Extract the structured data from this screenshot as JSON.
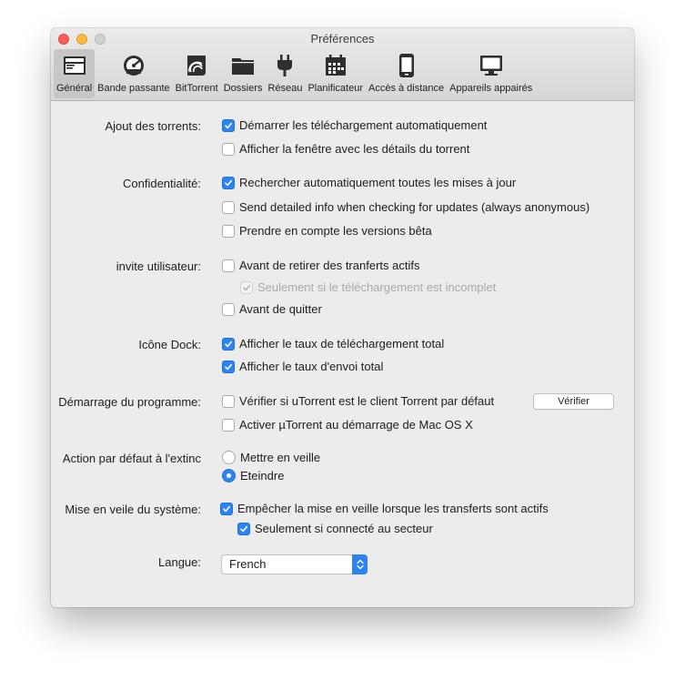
{
  "window": {
    "title": "Préférences"
  },
  "toolbar": [
    {
      "label": "Général",
      "icon": "general-icon",
      "selected": true
    },
    {
      "label": "Bande passante",
      "icon": "gauge-icon"
    },
    {
      "label": "BitTorrent",
      "icon": "bittorrent-icon"
    },
    {
      "label": "Dossiers",
      "icon": "folder-icon"
    },
    {
      "label": "Réseau",
      "icon": "plug-icon"
    },
    {
      "label": "Planificateur",
      "icon": "calendar-icon"
    },
    {
      "label": "Accès à distance",
      "icon": "phone-icon"
    },
    {
      "label": "Appareils appairés",
      "icon": "monitor-icon"
    }
  ],
  "sections": {
    "ajout": {
      "label": "Ajout des torrents:",
      "options": [
        {
          "label": "Démarrer les téléchargement automatiquement",
          "checked": true
        },
        {
          "label": "Afficher la fenêtre avec les détails du torrent",
          "checked": false
        }
      ]
    },
    "confidentialite": {
      "label": "Confidentialité:",
      "options": [
        {
          "label": "Rechercher automatiquement toutes les mises à jour",
          "checked": true
        },
        {
          "label": "Send detailed info when checking for updates (always anonymous)",
          "checked": false
        },
        {
          "label": "Prendre en compte les versions bêta",
          "checked": false
        }
      ]
    },
    "invite": {
      "label": "invite utilisateur:",
      "options": [
        {
          "label": "Avant de retirer des tranferts actifs",
          "checked": false
        },
        {
          "label": "Seulement si le téléchargement est incomplet",
          "checked": true,
          "disabled": true
        },
        {
          "label": "Avant de quitter",
          "checked": false
        }
      ]
    },
    "dock": {
      "label": "Icône Dock:",
      "options": [
        {
          "label": "Afficher le taux de téléchargement total",
          "checked": true
        },
        {
          "label": "Afficher le taux d'envoi total",
          "checked": true
        }
      ]
    },
    "demarrage": {
      "label": "Démarrage du programme:",
      "options": [
        {
          "label": "Vérifier si uTorrent est le client Torrent par défaut",
          "checked": false
        },
        {
          "label": "Activer µTorrent au démarrage de Mac OS X",
          "checked": false
        }
      ],
      "button": "Vérifier"
    },
    "action": {
      "label": "Action par défaut à l'extinc",
      "options": [
        {
          "label": "Mettre en veille",
          "selected": false
        },
        {
          "label": "Eteindre",
          "selected": true
        }
      ]
    },
    "veille": {
      "label": "Mise en veile du système:",
      "options": [
        {
          "label": "Empêcher la mise en veille lorsque les transferts sont actifs",
          "checked": true
        },
        {
          "label": "Seulement si connecté au secteur",
          "checked": true
        }
      ]
    },
    "langue": {
      "label": "Langue:",
      "value": "French"
    }
  },
  "colors": {
    "accent": "#2b84f1",
    "window_bg": "#ececec"
  }
}
